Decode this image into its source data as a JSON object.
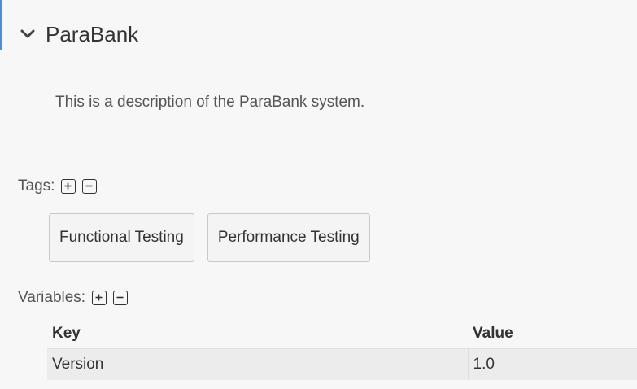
{
  "project": {
    "title": "ParaBank",
    "expanded": true,
    "description": "This is a description of the ParaBank system."
  },
  "tags": {
    "label": "Tags:",
    "items": [
      "Functional Testing",
      "Performance Testing"
    ]
  },
  "variables": {
    "label": "Variables:",
    "columns": {
      "key": "Key",
      "value": "Value"
    },
    "rows": [
      {
        "key": "Version",
        "value": "1.0"
      }
    ]
  },
  "colors": {
    "accent": "#4a90d9",
    "text": "#333333",
    "muted_text": "#555555",
    "background": "#f7f7f7"
  }
}
